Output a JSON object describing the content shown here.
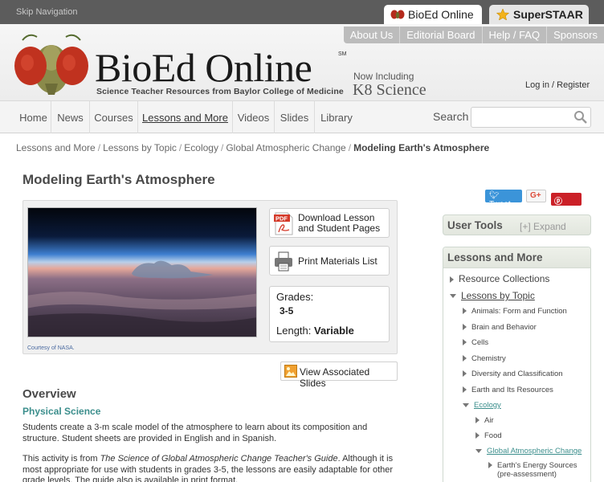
{
  "skip_nav": "Skip Navigation",
  "site_tabs": {
    "bioed": "BioEd Online",
    "superstaar": "SuperSTAAR"
  },
  "util_nav": [
    "About Us",
    "Editorial Board",
    "Help / FAQ",
    "Sponsors"
  ],
  "brand": {
    "name": "BioEd Online",
    "service_mark": "SM",
    "tagline": "Science Teacher Resources from Baylor College of Medicine",
    "now_including": "Now Including",
    "k8": "K8 Science"
  },
  "account": {
    "login": "Log in",
    "sep": "/",
    "register": "Register"
  },
  "main_nav": [
    "Home",
    "News",
    "Courses",
    "Lessons and More",
    "Videos",
    "Slides",
    "Library"
  ],
  "search": {
    "label": "Search",
    "placeholder": ""
  },
  "breadcrumb": [
    "Lessons and More",
    "Lessons by Topic",
    "Ecology",
    "Global Atmospheric Change",
    "Modeling Earth's Atmosphere"
  ],
  "page_title": "Modeling Earth's Atmosphere",
  "lesson": {
    "image_credit": "Courtesy of NASA.",
    "download_label_1": "Download Lesson",
    "download_label_2": "and Student Pages",
    "print_label": "Print Materials List",
    "grades_label": "Grades:",
    "grades_value": "3-5",
    "length_label": "Length:",
    "length_value": "Variable",
    "view_slides": "View Associated Slides"
  },
  "overview": {
    "heading": "Overview",
    "subject": "Physical Science",
    "para1": "Students create a 3-m scale model of the atmosphere to learn about its composition and structure. Student sheets are provided in English and in Spanish.",
    "para2_a": "This activity is from ",
    "para2_title": "The Science of Global Atmospheric Change Teacher's Guide",
    "para2_b": ". Although it is most appropriate for use with students in grades 3-5, the lessons are easily adaptable for other grade levels. The guide also is available in print format."
  },
  "social": {
    "tweet": "Tweet",
    "gplus": "G+",
    "save": "Save"
  },
  "user_tools": {
    "title": "User Tools",
    "expand": "[+] Expand"
  },
  "lessons_panel": {
    "title": "Lessons and More",
    "resource_collections": "Resource Collections",
    "lessons_by_topic": "Lessons by Topic",
    "topics": [
      "Animals: Form and Function",
      "Brain and Behavior",
      "Cells",
      "Chemistry",
      "Diversity and Classification",
      "Earth and Its Resources",
      "Ecology"
    ],
    "ecology_children": [
      "Air",
      "Food",
      "Global Atmospheric Change"
    ],
    "gac_child_1": "Earth's Energy Sources",
    "gac_child_2": "(pre-assessment)"
  },
  "colors": {
    "accent_teal": "#3b8e8c",
    "topbar": "#5c5c5c",
    "tweet_blue": "#3b94d9",
    "save_red": "#cb2027"
  }
}
